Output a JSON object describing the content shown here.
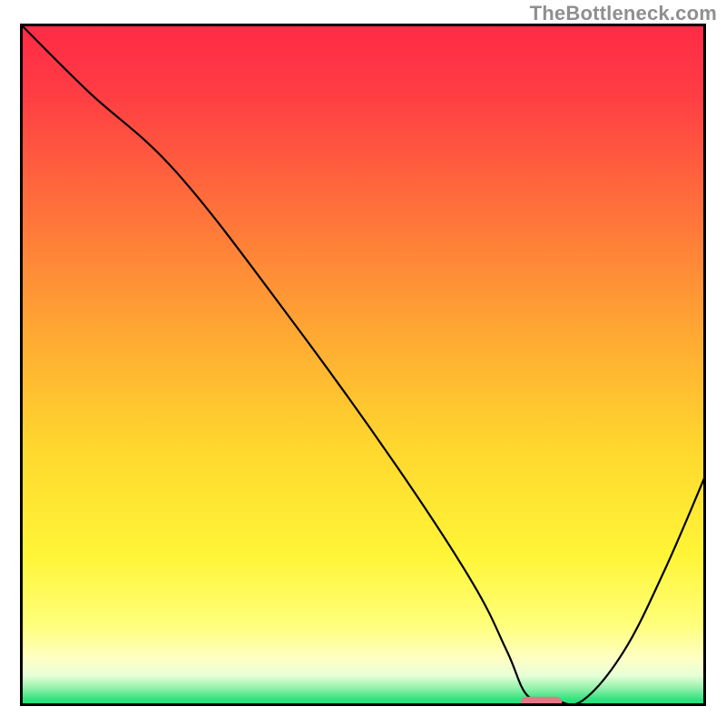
{
  "watermark": "TheBottleneck.com",
  "chart_data": {
    "type": "line",
    "title": "",
    "xlabel": "",
    "ylabel": "",
    "xlim": [
      0,
      100
    ],
    "ylim": [
      0,
      100
    ],
    "grid": false,
    "legend": false,
    "gradient_stops": [
      {
        "offset": 0.0,
        "color": "#ff2a46"
      },
      {
        "offset": 0.1,
        "color": "#ff3c44"
      },
      {
        "offset": 0.25,
        "color": "#ff6a3c"
      },
      {
        "offset": 0.45,
        "color": "#ffa733"
      },
      {
        "offset": 0.62,
        "color": "#ffd72e"
      },
      {
        "offset": 0.78,
        "color": "#fff537"
      },
      {
        "offset": 0.88,
        "color": "#ffff7a"
      },
      {
        "offset": 0.93,
        "color": "#ffffc4"
      },
      {
        "offset": 0.955,
        "color": "#e8ffd8"
      },
      {
        "offset": 0.975,
        "color": "#8ef0a8"
      },
      {
        "offset": 0.99,
        "color": "#2fe47e"
      },
      {
        "offset": 1.0,
        "color": "#1edc73"
      }
    ],
    "series": [
      {
        "name": "bottleneck-curve",
        "type": "line",
        "x": [
          0,
          10,
          23,
          40,
          55,
          66,
          71,
          74,
          78,
          82,
          88,
          94,
          100
        ],
        "y": [
          100,
          90,
          78,
          56,
          35,
          18,
          8,
          1.5,
          0.8,
          0.8,
          8,
          20,
          34
        ]
      }
    ],
    "marker": {
      "name": "optimal-marker",
      "x_center": 76,
      "y": 0.5,
      "width": 6,
      "color": "#e07a84"
    },
    "frame": {
      "stroke": "#000000",
      "stroke_width": 3
    }
  }
}
